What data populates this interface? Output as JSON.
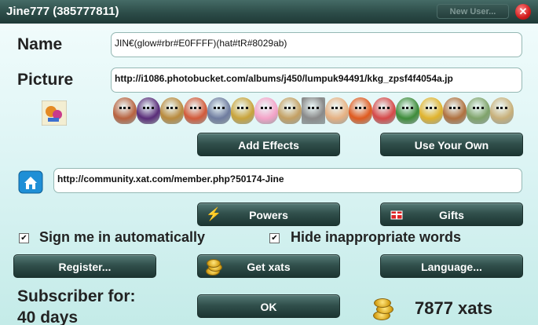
{
  "window": {
    "title": "Jine777 (385777811)",
    "new_user": "New User...",
    "close": "✕"
  },
  "name": {
    "label": "Name",
    "value": "JIN€(glow#rbr#E0FFFF)(hat#tR#8029ab)"
  },
  "picture": {
    "label": "Picture",
    "value": "http://i1086.photobucket.com/albums/j450/lumpuk94491/kkg_zpsf4f4054a.jp"
  },
  "avatar_icons": [
    "bald-man-avatar",
    "purple-hat-avatar",
    "dog-avatar",
    "redhead-girl-avatar",
    "robot-avatar",
    "goggles-avatar",
    "pink-pig-avatar",
    "dog-face-avatar",
    "bw-photo-avatar",
    "orange-hair-avatar",
    "crab-avatar",
    "rocket-avatar",
    "green-monster-avatar",
    "yellow-face-avatar",
    "brown-man-avatar",
    "fish-skeleton-avatar",
    "bumpy-face-avatar"
  ],
  "avatar_colors": [
    "#b8623f",
    "#5a2c79",
    "#b98a3d",
    "#d25a3a",
    "#6f7c9f",
    "#c9a43b",
    "#f4a3c8",
    "#c4a063",
    "#8a8a8a",
    "#e6b183",
    "#e05a1f",
    "#d64848",
    "#3e8c3a",
    "#e0b32d",
    "#b0713f",
    "#7fa36a",
    "#c8b07a"
  ],
  "buttons": {
    "add_effects": "Add Effects",
    "use_your_own": "Use Your Own",
    "powers": "Powers",
    "gifts": "Gifts",
    "register": "Register...",
    "get_xats": "Get xats",
    "language": "Language...",
    "ok": "OK"
  },
  "homepage": {
    "value": "http://community.xat.com/member.php?50174-Jine"
  },
  "options": {
    "sign_in_auto": {
      "label": "Sign me in automatically",
      "checked": "✔"
    },
    "hide_words": {
      "label": "Hide inappropriate words",
      "checked": "✔"
    }
  },
  "subscriber": {
    "line1": "Subscriber for:",
    "line2": "40 days"
  },
  "xats": {
    "count": "7877 xats"
  }
}
